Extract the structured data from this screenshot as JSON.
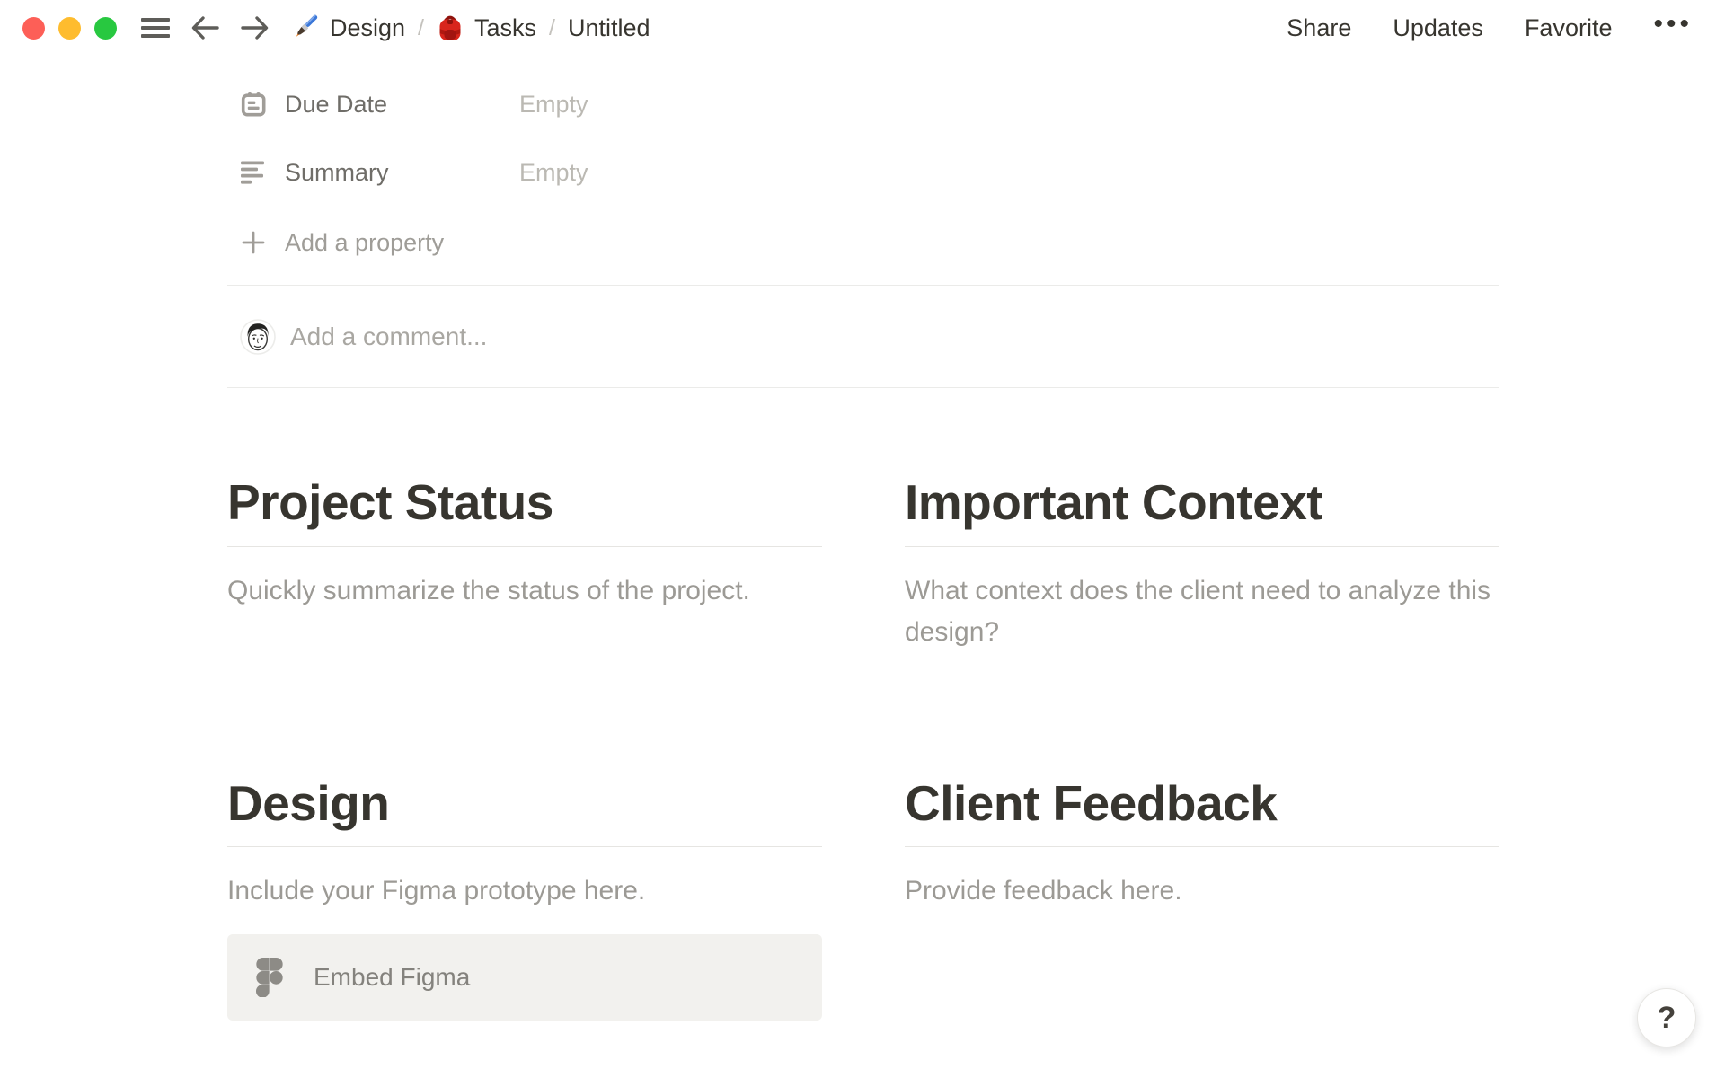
{
  "topbar": {
    "separator": "/",
    "breadcrumb": [
      {
        "icon": "paintbrush-icon",
        "label": "Design"
      },
      {
        "icon": "backpack-icon",
        "label": "Tasks"
      },
      {
        "icon": null,
        "label": "Untitled"
      }
    ],
    "actions": [
      {
        "id": "share",
        "label": "Share"
      },
      {
        "id": "updates",
        "label": "Updates"
      },
      {
        "id": "favorite",
        "label": "Favorite"
      }
    ],
    "more_label": "•••"
  },
  "properties": {
    "rows": [
      {
        "icon": "calendar-icon",
        "label": "Due Date",
        "value": "Empty"
      },
      {
        "icon": "text-align-left-icon",
        "label": "Summary",
        "value": "Empty"
      }
    ],
    "add_label": "Add a property"
  },
  "comment": {
    "placeholder": "Add a comment..."
  },
  "sections": [
    {
      "title": "Project Status",
      "body": "Quickly summarize the status of the project."
    },
    {
      "title": "Important Context",
      "body": "What context does the client need to analyze this design?"
    },
    {
      "title": "Design",
      "body": "Include your Figma prototype here.",
      "embed_label": "Embed Figma"
    },
    {
      "title": "Client Feedback",
      "body": "Provide feedback here."
    }
  ],
  "help": {
    "label": "?"
  },
  "colors": {
    "traffic_red": "#fd5f57",
    "traffic_yellow": "#febc2e",
    "traffic_green": "#28c840",
    "text": "#37352f",
    "muted_text": "#9c9a95",
    "empty_text": "#bbb9b3",
    "divider": "#ebebe9",
    "embed_bg": "#f2f1ee",
    "icon_gray": "#a09d98"
  }
}
